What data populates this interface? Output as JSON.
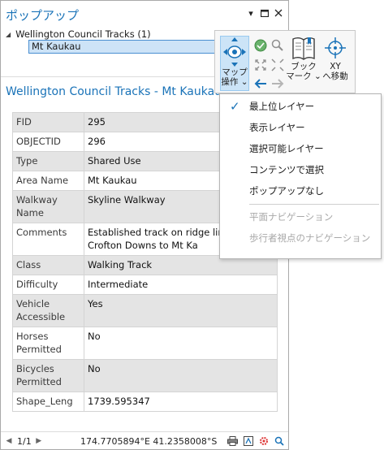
{
  "popup": {
    "title": "ポップアップ",
    "layer_label": "Wellington Council Tracks  (1)",
    "feature_label": "Mt Kaukau",
    "feature_title": "Wellington Council Tracks - Mt Kaukau",
    "attributes": [
      {
        "field": "FID",
        "value": "295"
      },
      {
        "field": "OBJECTID",
        "value": "296"
      },
      {
        "field": "Type",
        "value": "Shared Use"
      },
      {
        "field": "Area Name",
        "value": "Mt Kaukau"
      },
      {
        "field": "Walkway Name",
        "value": "Skyline Walkway"
      },
      {
        "field": "Comments",
        "value": "Established track on ridge link Drive, Crofton Downs to Mt Ka"
      },
      {
        "field": "Class",
        "value": "Walking Track"
      },
      {
        "field": "Difficulty",
        "value": "Intermediate"
      },
      {
        "field": "Vehicle Accessible",
        "value": "Yes"
      },
      {
        "field": "Horses Permitted",
        "value": "No"
      },
      {
        "field": "Bicycles Permitted",
        "value": "No"
      },
      {
        "field": "Shape_Leng",
        "value": "1739.595347"
      }
    ],
    "status": {
      "page": "1/1",
      "coords": "174.7705894°E 41.2358008°S"
    }
  },
  "ribbon": {
    "map_op_label": "マップ\n操作",
    "bookmark_label": "ブック\nマーク",
    "xy_label": "XY\nへ移動"
  },
  "dropdown": {
    "items": [
      {
        "label": "最上位レイヤー",
        "checked": true,
        "enabled": true
      },
      {
        "label": "表示レイヤー",
        "checked": false,
        "enabled": true
      },
      {
        "label": "選択可能レイヤー",
        "checked": false,
        "enabled": true
      },
      {
        "label": "コンテンツで選択",
        "checked": false,
        "enabled": true
      },
      {
        "label": "ポップアップなし",
        "checked": false,
        "enabled": true
      },
      {
        "label": "平面ナビゲーション",
        "checked": false,
        "enabled": false
      },
      {
        "label": "歩行者視点のナビゲーション",
        "checked": false,
        "enabled": false
      }
    ]
  },
  "colors": {
    "title_blue": "#1a73b8",
    "selection_fill": "#cde3f7",
    "selection_border": "#4a8fd1",
    "row_shade": "#e4e4e4",
    "disabled_text": "#a8a8a8"
  },
  "icons": [
    "caret-down-icon",
    "chevron-down-icon",
    "restore-icon",
    "close-icon",
    "prev-icon",
    "next-icon",
    "map-navigate-icon",
    "bookmark-icon",
    "xy-target-icon",
    "back-arrow-icon",
    "forward-arrow-icon",
    "full-extent-icon",
    "checkmark-icon"
  ]
}
